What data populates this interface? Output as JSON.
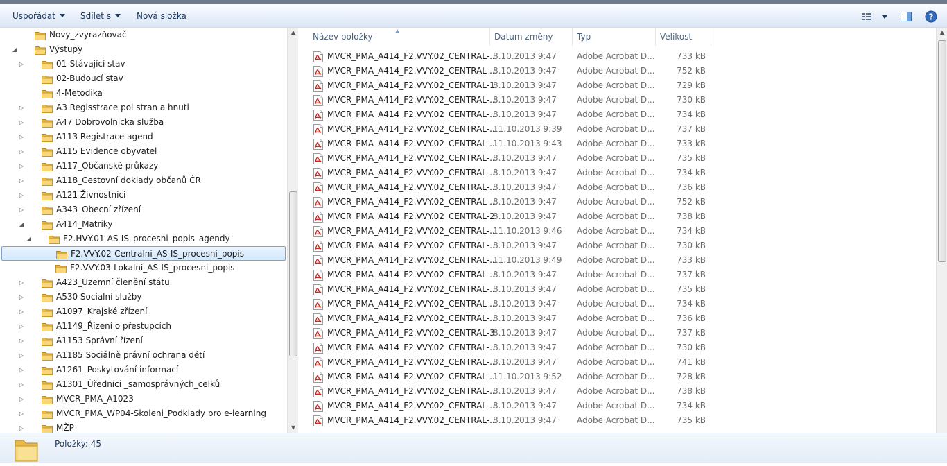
{
  "toolbar": {
    "organize_label": "Uspořádat",
    "share_label": "Sdílet s",
    "new_folder_label": "Nová složka"
  },
  "nav_tree": [
    {
      "label": "Novy_zvyrazňovač",
      "depth": 1,
      "expander": "",
      "selected": false
    },
    {
      "label": "Výstupy",
      "depth": 1,
      "expander": "expanded",
      "selected": false
    },
    {
      "label": "01-Stávající stav",
      "depth": 2,
      "expander": "collapsed",
      "selected": false
    },
    {
      "label": "02-Budoucí stav",
      "depth": 2,
      "expander": "",
      "selected": false
    },
    {
      "label": "4-Metodika",
      "depth": 2,
      "expander": "",
      "selected": false
    },
    {
      "label": "A3 Regisstrace pol stran a hnuti",
      "depth": 2,
      "expander": "collapsed",
      "selected": false
    },
    {
      "label": "A47 Dobrovolnicka služba",
      "depth": 2,
      "expander": "collapsed",
      "selected": false
    },
    {
      "label": "A113 Registrace agend",
      "depth": 2,
      "expander": "collapsed",
      "selected": false
    },
    {
      "label": "A115 Evidence obyvatel",
      "depth": 2,
      "expander": "collapsed",
      "selected": false
    },
    {
      "label": "A117_Občanské průkazy",
      "depth": 2,
      "expander": "collapsed",
      "selected": false
    },
    {
      "label": "A118_Cestovní doklady občanů ČR",
      "depth": 2,
      "expander": "collapsed",
      "selected": false
    },
    {
      "label": "A121 Živnostnici",
      "depth": 2,
      "expander": "collapsed",
      "selected": false
    },
    {
      "label": "A343_Obecní zřízení",
      "depth": 2,
      "expander": "collapsed",
      "selected": false
    },
    {
      "label": "A414_Matriky",
      "depth": 2,
      "expander": "expanded",
      "selected": false
    },
    {
      "label": "F2.HVY.01-AS-IS_procesni_popis_agendy",
      "depth": 3,
      "expander": "expanded",
      "selected": false
    },
    {
      "label": "F2.VVY.02-Centralni_AS-IS_procesni_popis",
      "depth": 4,
      "expander": "",
      "selected": true
    },
    {
      "label": "F2.VVY.03-Lokalni_AS-IS_procesni_popis",
      "depth": 4,
      "expander": "",
      "selected": false
    },
    {
      "label": "A423_Územní členění státu",
      "depth": 2,
      "expander": "collapsed",
      "selected": false
    },
    {
      "label": "A530 Socialní služby",
      "depth": 2,
      "expander": "collapsed",
      "selected": false
    },
    {
      "label": "A1097_Krajské zřízení",
      "depth": 2,
      "expander": "collapsed",
      "selected": false
    },
    {
      "label": "A1149_Řízení o přestupcích",
      "depth": 2,
      "expander": "collapsed",
      "selected": false
    },
    {
      "label": "A1153 Správní řízení",
      "depth": 2,
      "expander": "collapsed",
      "selected": false
    },
    {
      "label": "A1185 Sociálně právní ochrana dětí",
      "depth": 2,
      "expander": "collapsed",
      "selected": false
    },
    {
      "label": "A1261_Poskytování informací",
      "depth": 2,
      "expander": "collapsed",
      "selected": false
    },
    {
      "label": "A1301_Úředníci _samosprávných_celků",
      "depth": 2,
      "expander": "collapsed",
      "selected": false
    },
    {
      "label": "MVCR_PMA_A1023",
      "depth": 2,
      "expander": "collapsed",
      "selected": false
    },
    {
      "label": "MVCR_PMA_WP04-Skoleni_Podklady pro e-learning",
      "depth": 2,
      "expander": "collapsed",
      "selected": false
    },
    {
      "label": "MŽP",
      "depth": 2,
      "expander": "collapsed",
      "selected": false
    }
  ],
  "columns": {
    "name": "Název položky",
    "date": "Datum změny",
    "type": "Typ",
    "size": "Velikost"
  },
  "files": [
    {
      "name": "MVCR_PMA_A414_F2.VVY.02_CENTRAL-...",
      "date": "8.10.2013 9:47",
      "type": "Adobe Acrobat D...",
      "size": "733 kB"
    },
    {
      "name": "MVCR_PMA_A414_F2.VVY.02_CENTRAL-...",
      "date": "8.10.2013 9:47",
      "type": "Adobe Acrobat D...",
      "size": "752 kB"
    },
    {
      "name": "MVCR_PMA_A414_F2.VVY.02_CENTRAL-1",
      "date": "8.10.2013 9:47",
      "type": "Adobe Acrobat D...",
      "size": "729 kB"
    },
    {
      "name": "MVCR_PMA_A414_F2.VVY.02_CENTRAL-...",
      "date": "8.10.2013 9:47",
      "type": "Adobe Acrobat D...",
      "size": "730 kB"
    },
    {
      "name": "MVCR_PMA_A414_F2.VVY.02_CENTRAL-...",
      "date": "8.10.2013 9:47",
      "type": "Adobe Acrobat D...",
      "size": "734 kB"
    },
    {
      "name": "MVCR_PMA_A414_F2.VVY.02_CENTRAL-...",
      "date": "11.10.2013 9:39",
      "type": "Adobe Acrobat D...",
      "size": "737 kB"
    },
    {
      "name": "MVCR_PMA_A414_F2.VVY.02_CENTRAL-...",
      "date": "11.10.2013 9:43",
      "type": "Adobe Acrobat D...",
      "size": "733 kB"
    },
    {
      "name": "MVCR_PMA_A414_F2.VVY.02_CENTRAL-...",
      "date": "8.10.2013 9:47",
      "type": "Adobe Acrobat D...",
      "size": "735 kB"
    },
    {
      "name": "MVCR_PMA_A414_F2.VVY.02_CENTRAL-...",
      "date": "8.10.2013 9:47",
      "type": "Adobe Acrobat D...",
      "size": "734 kB"
    },
    {
      "name": "MVCR_PMA_A414_F2.VVY.02_CENTRAL-...",
      "date": "8.10.2013 9:47",
      "type": "Adobe Acrobat D...",
      "size": "736 kB"
    },
    {
      "name": "MVCR_PMA_A414_F2.VVY.02_CENTRAL-...",
      "date": "8.10.2013 9:47",
      "type": "Adobe Acrobat D...",
      "size": "752 kB"
    },
    {
      "name": "MVCR_PMA_A414_F2.VVY.02_CENTRAL-2",
      "date": "8.10.2013 9:47",
      "type": "Adobe Acrobat D...",
      "size": "738 kB"
    },
    {
      "name": "MVCR_PMA_A414_F2.VVY.02_CENTRAL-...",
      "date": "11.10.2013 9:46",
      "type": "Adobe Acrobat D...",
      "size": "734 kB"
    },
    {
      "name": "MVCR_PMA_A414_F2.VVY.02_CENTRAL-...",
      "date": "8.10.2013 9:47",
      "type": "Adobe Acrobat D...",
      "size": "730 kB"
    },
    {
      "name": "MVCR_PMA_A414_F2.VVY.02_CENTRAL-...",
      "date": "11.10.2013 9:49",
      "type": "Adobe Acrobat D...",
      "size": "733 kB"
    },
    {
      "name": "MVCR_PMA_A414_F2.VVY.02_CENTRAL-...",
      "date": "8.10.2013 9:47",
      "type": "Adobe Acrobat D...",
      "size": "737 kB"
    },
    {
      "name": "MVCR_PMA_A414_F2.VVY.02_CENTRAL-...",
      "date": "8.10.2013 9:47",
      "type": "Adobe Acrobat D...",
      "size": "735 kB"
    },
    {
      "name": "MVCR_PMA_A414_F2.VVY.02_CENTRAL-...",
      "date": "8.10.2013 9:47",
      "type": "Adobe Acrobat D...",
      "size": "734 kB"
    },
    {
      "name": "MVCR_PMA_A414_F2.VVY.02_CENTRAL-...",
      "date": "8.10.2013 9:47",
      "type": "Adobe Acrobat D...",
      "size": "736 kB"
    },
    {
      "name": "MVCR_PMA_A414_F2.VVY.02_CENTRAL-3",
      "date": "8.10.2013 9:47",
      "type": "Adobe Acrobat D...",
      "size": "737 kB"
    },
    {
      "name": "MVCR_PMA_A414_F2.VVY.02_CENTRAL-...",
      "date": "8.10.2013 9:47",
      "type": "Adobe Acrobat D...",
      "size": "730 kB"
    },
    {
      "name": "MVCR_PMA_A414_F2.VVY.02_CENTRAL-...",
      "date": "8.10.2013 9:47",
      "type": "Adobe Acrobat D...",
      "size": "741 kB"
    },
    {
      "name": "MVCR_PMA_A414_F2.VVY.02_CENTRAL-...",
      "date": "11.10.2013 9:52",
      "type": "Adobe Acrobat D...",
      "size": "728 kB"
    },
    {
      "name": "MVCR_PMA_A414_F2.VVY.02_CENTRAL-...",
      "date": "8.10.2013 9:47",
      "type": "Adobe Acrobat D...",
      "size": "738 kB"
    },
    {
      "name": "MVCR_PMA_A414_F2.VVY.02_CENTRAL-...",
      "date": "8.10.2013 9:47",
      "type": "Adobe Acrobat D...",
      "size": "734 kB"
    },
    {
      "name": "MVCR_PMA_A414_F2.VVY.02_CENTRAL-...",
      "date": "8.10.2013 9:47",
      "type": "Adobe Acrobat D...",
      "size": "735 kB"
    }
  ],
  "status": {
    "item_count": "Položky: 45"
  },
  "icons": {
    "folder": "folder-icon",
    "pdf": "pdf-file-icon",
    "views": "view-options-icon",
    "preview": "preview-pane-icon",
    "help": "help-icon"
  },
  "colors": {
    "selection_fill": "#d2e8fd",
    "selection_border": "#7da2ce",
    "folder": "#f0c95c",
    "pdf_red": "#c8221a"
  }
}
